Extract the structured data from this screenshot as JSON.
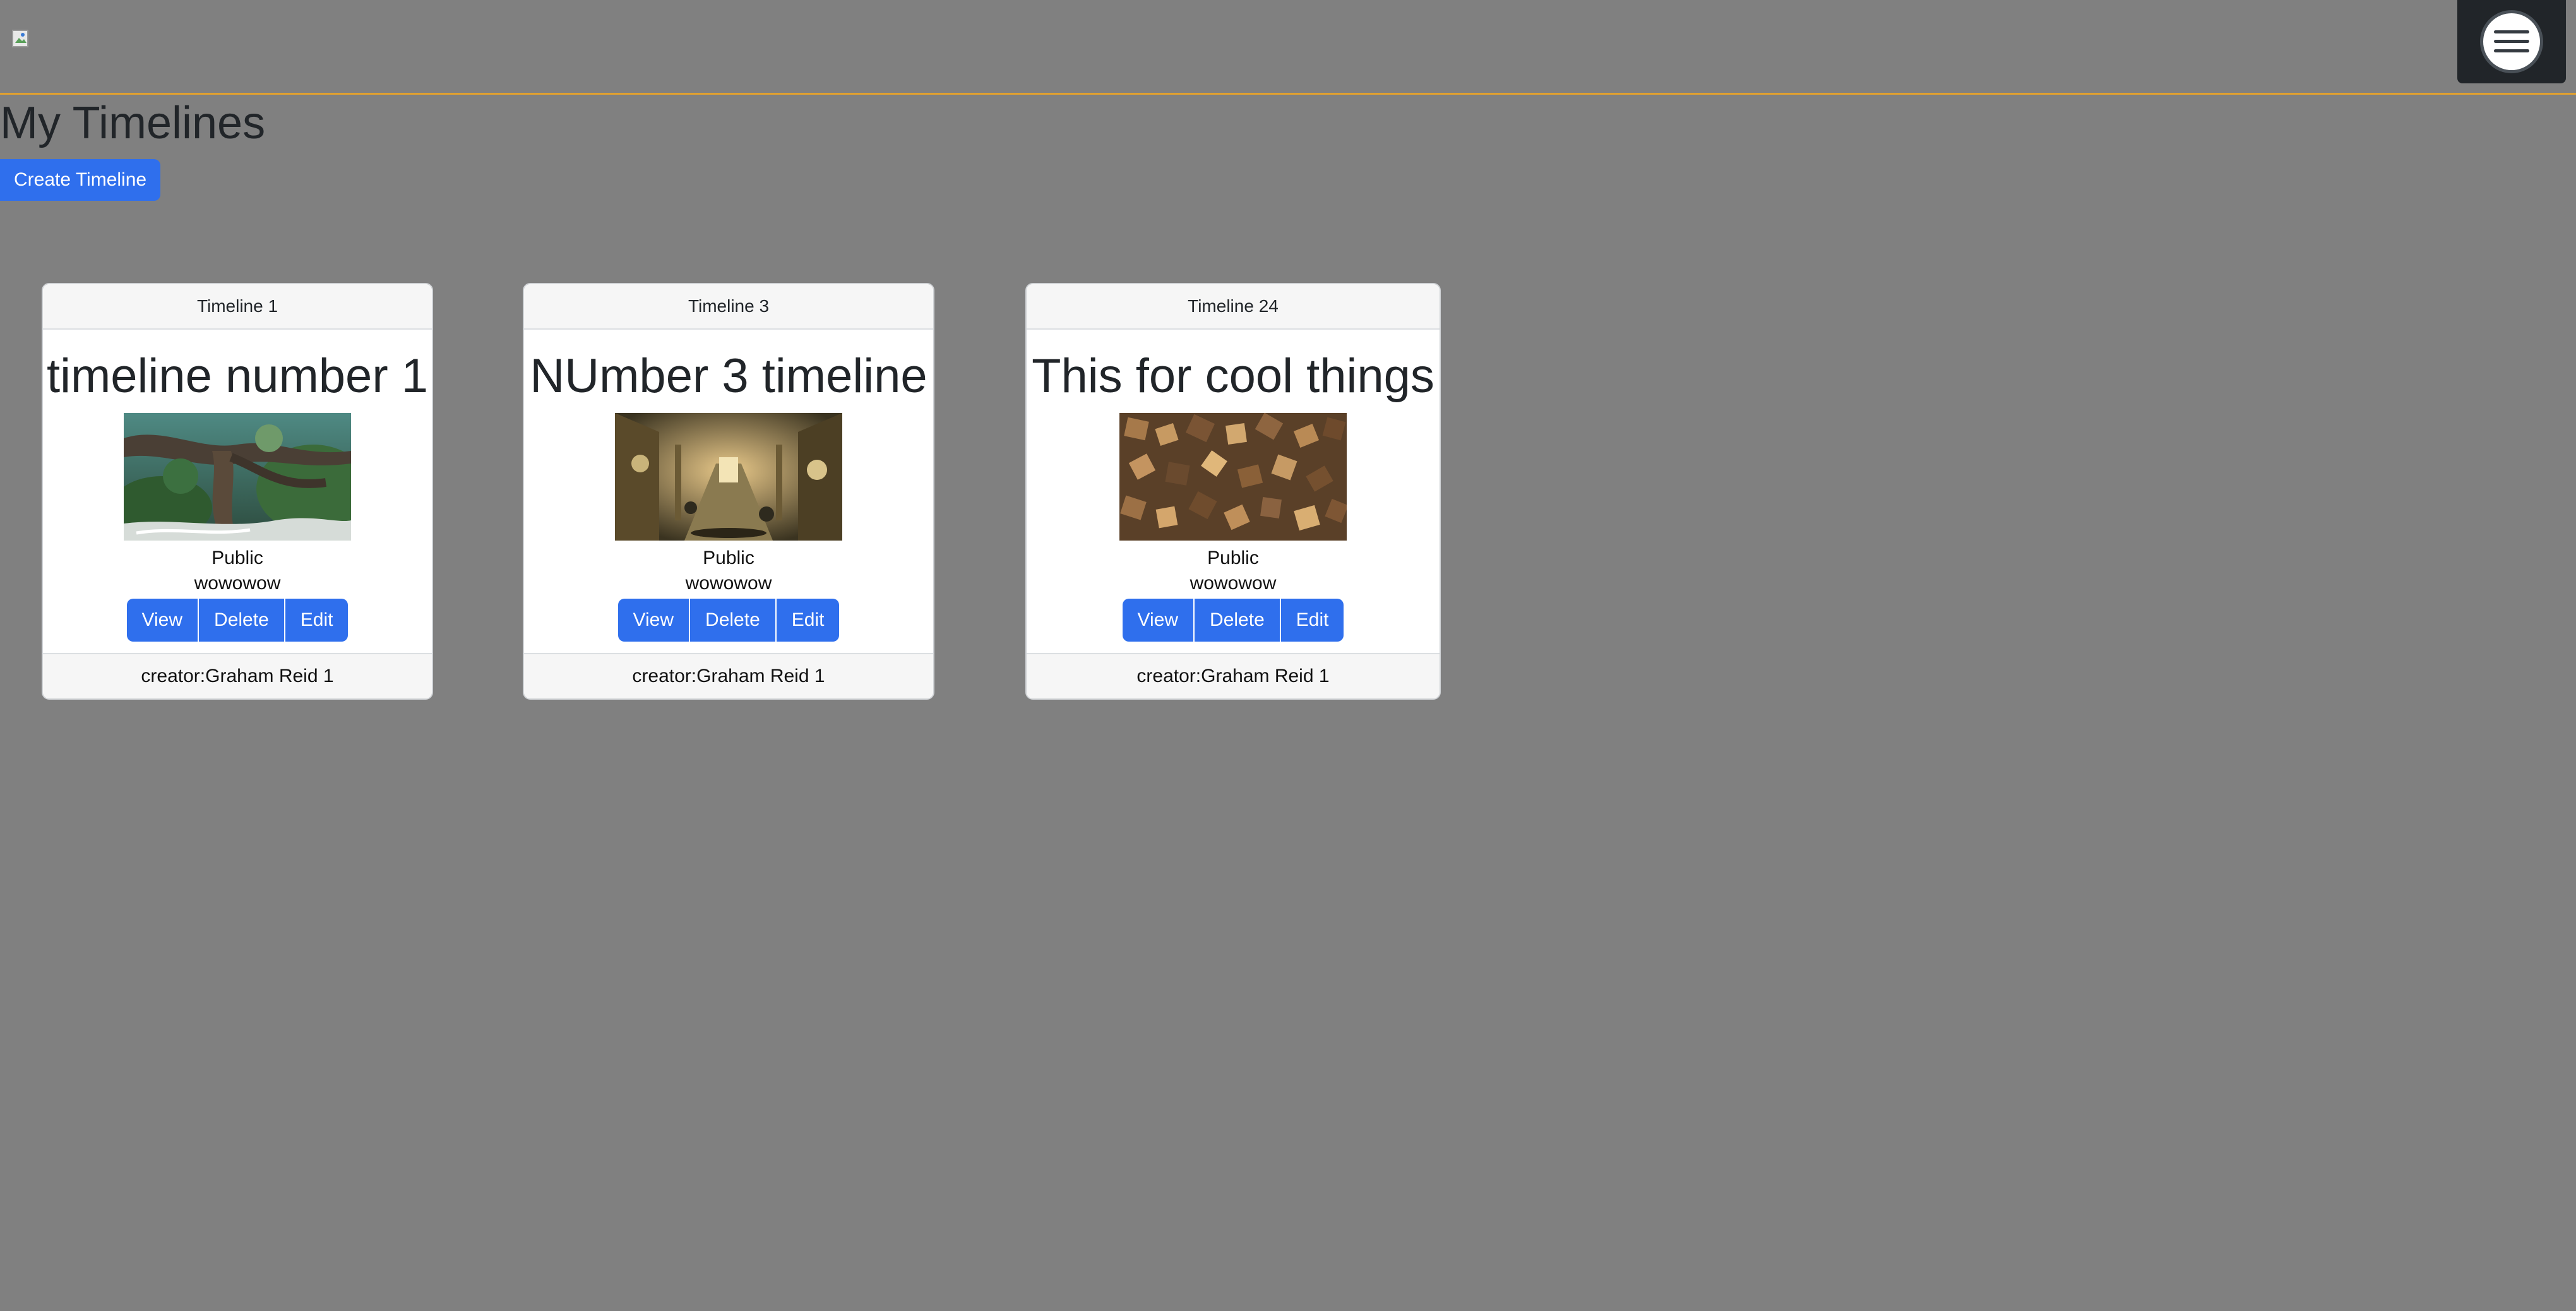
{
  "header": {
    "logo_alt": "",
    "menu_icon": "hamburger-icon"
  },
  "page": {
    "title": "My Timelines",
    "create_label": "Create Timeline"
  },
  "cards": [
    {
      "header": "Timeline 1",
      "title": "timeline number 1",
      "image": "jungle-tree-painting",
      "visibility": "Public",
      "description": "wowowow",
      "view_label": "View",
      "delete_label": "Delete",
      "edit_label": "Edit",
      "footer": "creator:Graham Reid 1"
    },
    {
      "header": "Timeline 3",
      "title": "NUmber 3 timeline",
      "image": "fantasy-hall-painting",
      "visibility": "Public",
      "description": "wowowow",
      "view_label": "View",
      "delete_label": "Delete",
      "edit_label": "Edit",
      "footer": "creator:Graham Reid 1"
    },
    {
      "header": "Timeline 24",
      "title": "This for cool things",
      "image": "wooden-cubes-photo",
      "visibility": "Public",
      "description": "wowowow",
      "view_label": "View",
      "delete_label": "Delete",
      "edit_label": "Edit",
      "footer": "creator:Graham Reid 1"
    }
  ],
  "colors": {
    "background": "#808080",
    "primary": "#2f6fed",
    "navbar_border": "#e0a030",
    "menu_bg": "#212529"
  }
}
